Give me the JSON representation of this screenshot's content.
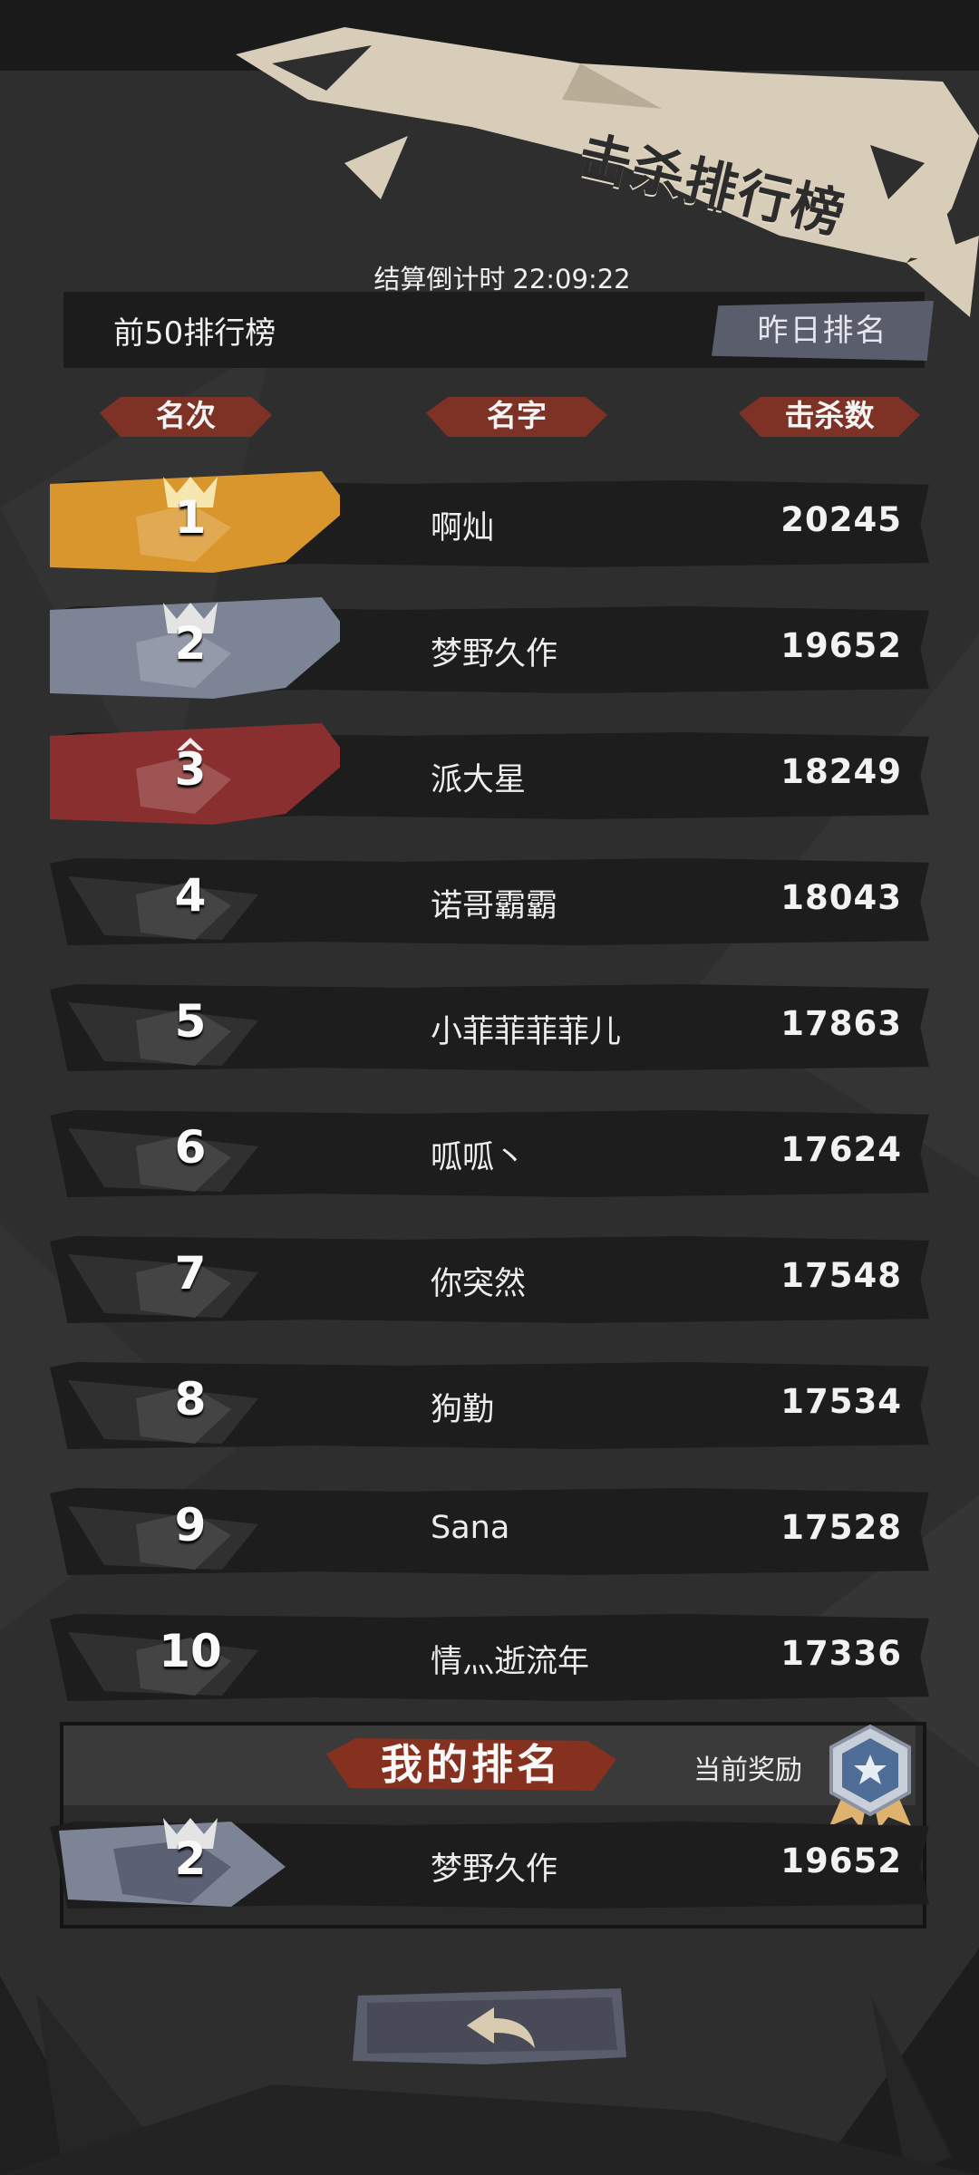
{
  "title": "击杀排行榜",
  "countdown": {
    "label": "结算倒计时",
    "time": "22:09:22"
  },
  "top_label": "前50排行榜",
  "yesterday_button": "昨日排名",
  "columns": {
    "rank": "名次",
    "name": "名字",
    "kills": "击杀数"
  },
  "rows": [
    {
      "rank": "1",
      "name": "啊灿",
      "kills": "20245"
    },
    {
      "rank": "2",
      "name": "梦野久作",
      "kills": "19652"
    },
    {
      "rank": "3",
      "name": "派大星",
      "kills": "18249"
    },
    {
      "rank": "4",
      "name": "诺哥霸霸",
      "kills": "18043"
    },
    {
      "rank": "5",
      "name": "小菲菲菲菲儿",
      "kills": "17863"
    },
    {
      "rank": "6",
      "name": "呱呱丶",
      "kills": "17624"
    },
    {
      "rank": "7",
      "name": "你突然",
      "kills": "17548"
    },
    {
      "rank": "8",
      "name": "狗勤",
      "kills": "17534"
    },
    {
      "rank": "9",
      "name": "Sana",
      "kills": "17528"
    },
    {
      "rank": "10",
      "name": "情灬逝流年",
      "kills": "17336"
    }
  ],
  "my_rank": {
    "title": "我的排名",
    "reward_label": "当前奖励",
    "rank": "2",
    "name": "梦野久作",
    "kills": "19652"
  },
  "icons": {
    "back": "back-arrow-icon",
    "reward": "medal-badge-icon",
    "crown": "crown-icon"
  },
  "colors": {
    "gold": "#d9962c",
    "silver": "#7d8496",
    "bronze": "#8a2f2f",
    "ribbon": "#8c3224",
    "banner": "#d8cdb8"
  }
}
